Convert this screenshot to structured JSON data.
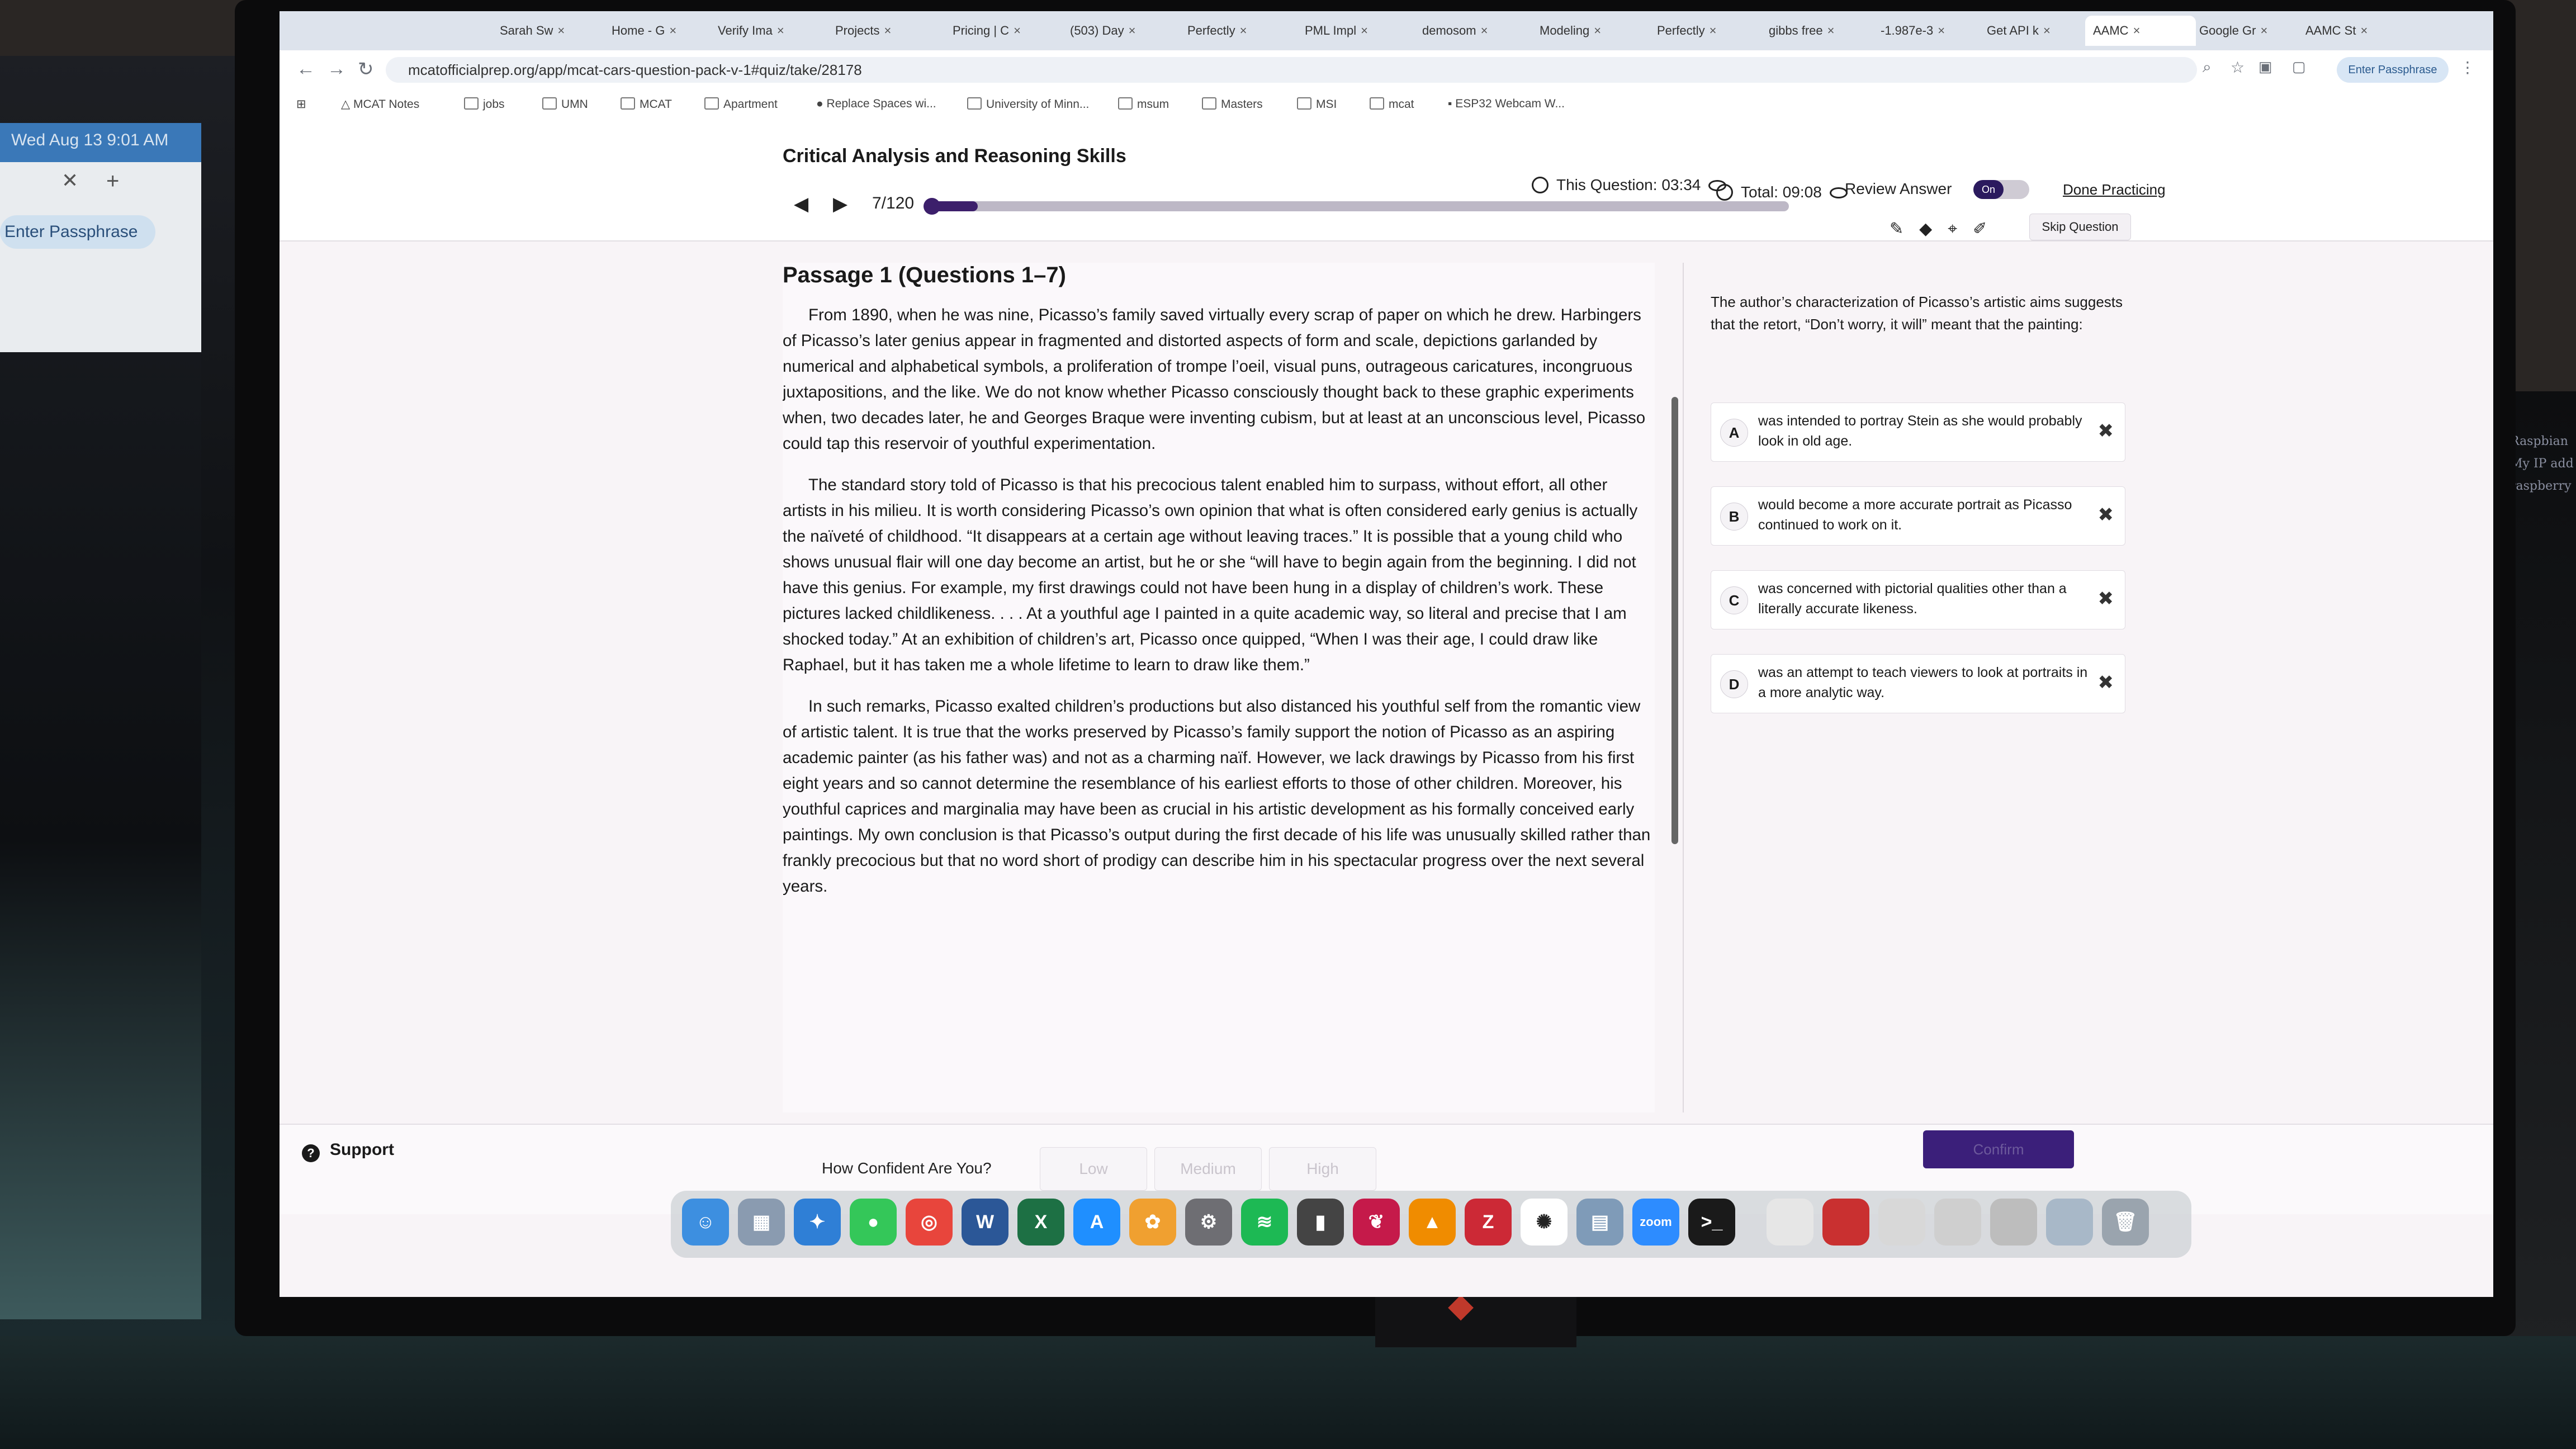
{
  "environment": {
    "left_screen": {
      "date": "Wed Aug 13 9:01 AM",
      "passphrase_button": "Enter Passphrase"
    },
    "right_screen_text": [
      "Raspbian",
      "My IP add",
      "raspberry"
    ]
  },
  "browser": {
    "tabs": [
      "Sarah Sw",
      "Home - G",
      "Verify Ima",
      "Projects",
      "Pricing | C",
      "(503) Day",
      "Perfectly",
      "PML Impl",
      "demosom",
      "Modeling",
      "Perfectly",
      "gibbs free",
      "-1.987e-3",
      "Get API k",
      "AAMC",
      "Google Gr",
      "AAMC St"
    ],
    "active_tab": "AAMC",
    "url": "mcatofficialprep.org/app/mcat-cars-question-pack-v-1#quiz/take/28178",
    "profile_button": "Enter Passphrase",
    "bookmarks": [
      "MCAT Notes",
      "jobs",
      "UMN",
      "MCAT",
      "Apartment",
      "Replace Spaces wi...",
      "University of Minn...",
      "msum",
      "Masters",
      "MSI",
      "mcat",
      "ESP32 Webcam W..."
    ]
  },
  "header": {
    "section_title": "Critical Analysis and Reasoning Skills",
    "counter": "7/120",
    "progress": 0.058,
    "this_question_label": "This Question:",
    "this_question_time": "03:34",
    "total_label": "Total:",
    "total_time": "09:08",
    "review_label": "Review Answer",
    "review_state": "On",
    "done_label": "Done Practicing",
    "skip_label": "Skip Question"
  },
  "passage": {
    "title": "Passage 1 (Questions 1–7)",
    "paragraphs": [
      "From 1890, when he was nine, Picasso’s family saved virtually every scrap of paper on which he drew. Harbingers of Picasso’s later genius appear in fragmented and distorted aspects of form and scale, depictions garlanded by numerical and alphabetical symbols, a proliferation of trompe l’oeil, visual puns, outrageous caricatures, incongruous juxtapositions, and the like. We do not know whether Picasso consciously thought back to these graphic experiments when, two decades later, he and Georges Braque were inventing cubism, but at least at an unconscious level, Picasso could tap this reservoir of youthful experimentation.",
      "The standard story told of Picasso is that his precocious talent enabled him to surpass, without effort, all other artists in his milieu. It is worth considering Picasso’s own opinion that what is often considered early genius is actually the naïveté of childhood. “It disappears at a certain age without leaving traces.” It is possible that a young child who shows unusual flair will one day become an artist, but he or she “will have to begin again from the beginning. I did not have this genius. For example, my first drawings could not have been hung in a display of children’s work. These pictures lacked childlikeness. . . . At a youthful age I painted in a quite academic way, so literal and precise that I am shocked today.” At an exhibition of children’s art, Picasso once quipped, “When I was their age, I could draw like Raphael, but it has taken me a whole lifetime to learn to draw like them.”",
      "In such remarks, Picasso exalted children’s productions but also distanced his youthful self from the romantic view of artistic talent. It is true that the works preserved by Picasso’s family support the notion of Picasso as an aspiring academic painter (as his father was) and not as a charming naïf. However, we lack drawings by Picasso from his first eight years and so cannot determine the resemblance of his earliest efforts to those of other children. Moreover, his youthful caprices and marginalia may have been as crucial in his artistic development as his formally conceived early paintings. My own conclusion is that Picasso’s output during the first decade of his life was unusually skilled rather than frankly precocious but that no word short of prodigy can describe him in his spectacular progress over the next several years."
    ]
  },
  "question": {
    "stem": "The author’s characterization of Picasso’s artistic aims suggests that the retort, “Don’t worry, it will” meant that the painting:",
    "choices": [
      {
        "letter": "A",
        "text": "was intended to portray Stein as she would probably look in old age."
      },
      {
        "letter": "B",
        "text": "would become a more accurate portrait as Picasso continued to work on it."
      },
      {
        "letter": "C",
        "text": "was concerned with pictorial qualities other than a literally accurate likeness."
      },
      {
        "letter": "D",
        "text": "was an attempt to teach viewers to look at portraits in a more analytic way."
      }
    ]
  },
  "footer": {
    "confidence_label": "How Confident Are You?",
    "confidence_options": [
      "Low",
      "Medium",
      "High"
    ],
    "confirm_label": "Confirm",
    "support_label": "Support"
  },
  "dock": {
    "items": [
      "finder-icon",
      "launchpad-icon",
      "safari-icon",
      "messages-icon",
      "chrome-icon",
      "word-icon",
      "excel-icon",
      "app-store-icon",
      "photos-icon",
      "system-settings-icon",
      "spotify-icon",
      "notes-icon",
      "raspberry-pi-icon",
      "vlc-icon",
      "zotero-icon",
      "chatgpt-icon",
      "preview-icon",
      "zoom-icon",
      "terminal-icon"
    ],
    "zoom_label": "zoom",
    "zotero_label": "Z"
  },
  "colors": {
    "accent": "#3c1f6b",
    "confirm": "#3b1f7a",
    "background": "#f8f4f7"
  }
}
